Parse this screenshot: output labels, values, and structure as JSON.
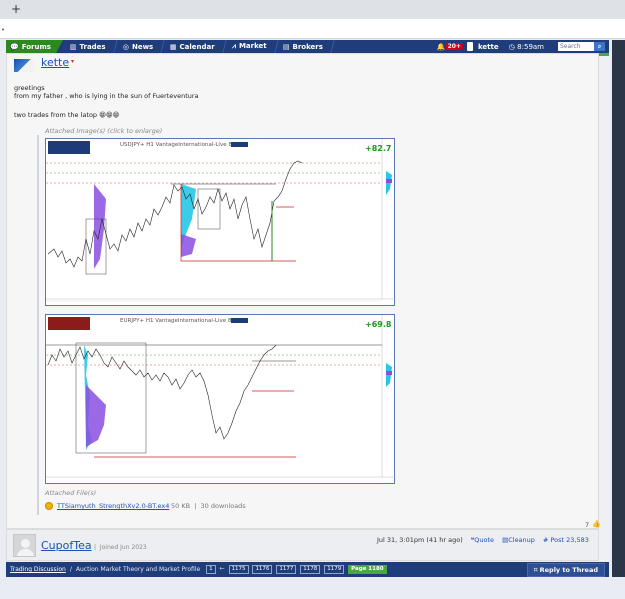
{
  "browser": {
    "new_tab": "+"
  },
  "navbar": {
    "items": [
      {
        "label": "Forums",
        "icon": "chat-icon"
      },
      {
        "label": "Trades",
        "icon": "bar-chart-icon"
      },
      {
        "label": "News",
        "icon": "globe-icon"
      },
      {
        "label": "Calendar",
        "icon": "calendar-icon"
      },
      {
        "label": "Market",
        "icon": "line-chart-icon"
      },
      {
        "label": "Brokers",
        "icon": "building-icon"
      }
    ],
    "notifications": "20+",
    "user": "kette",
    "time": "8:59am",
    "search_placeholder": "Search"
  },
  "post": {
    "username": "kette",
    "flag": "▾",
    "greeting_lines": [
      "greetings",
      "from my father , who is lying in the sun of Fuerteventura",
      "two trades from the latop 😁😁😁"
    ],
    "attached_images_label": "Attached Image(s) (click to enlarge)",
    "charts": [
      {
        "title": "USDJPY+ H1 VantageInternational-Live 8",
        "pnl": "+82.7"
      },
      {
        "title": "EURJPY+ H1 VantageInternational-Live 8",
        "pnl": "+69.8"
      }
    ],
    "attached_files_label": "Attached File(s)",
    "file_name": "TTSiamyuth_StrengthXv2.0-BT.ex4",
    "file_size": "50 KB",
    "file_downloads": "30 downloads",
    "likes": "7"
  },
  "next_post": {
    "username": "CupofTea",
    "joined": "Joined Jun 2023",
    "time": "Jul 31, 3:01pm (41 hr ago)",
    "quote": "Quote",
    "cleanup": "Cleanup",
    "post_number": "Post 23,583"
  },
  "breadcrumb": {
    "forum": "Trading Discussion",
    "thread": "Auction Market Theory and Market Profile",
    "pages": [
      "1",
      "←",
      "1175",
      "1176",
      "1177",
      "1178",
      "1179",
      "Page 1180"
    ],
    "reply_label": "Reply to Thread"
  }
}
